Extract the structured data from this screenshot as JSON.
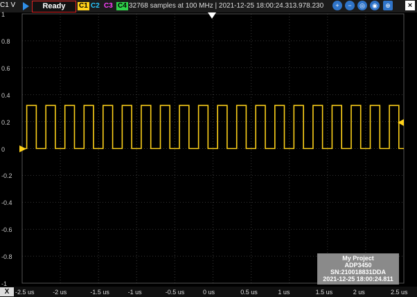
{
  "toolbar": {
    "status": "Ready",
    "channels": [
      "C1",
      "C2",
      "C3",
      "C4"
    ],
    "acquisition": "32768 samples at 100 MHz | 2021-12-25 18:00:24.313.978.230",
    "tool_icons": [
      "zoom-in-icon",
      "zoom-out-icon",
      "zoom-fit-icon",
      "zoom-region-icon",
      "cursor-icon"
    ],
    "close_glyph": "×"
  },
  "channel_unit": "C1 V",
  "y_ticks": [
    "1",
    "0.8",
    "0.6",
    "0.4",
    "0.2",
    "0",
    "-0.2",
    "-0.4",
    "-0.6",
    "-0.8",
    "-1"
  ],
  "x_axis_label": "X",
  "x_ticks": [
    "-2.5 us",
    "-2 us",
    "-1.5 us",
    "-1 us",
    "-0.5 us",
    "0 us",
    "0.5 us",
    "1 us",
    "1.5 us",
    "2 us",
    "2.5 us"
  ],
  "info_box": {
    "line1": "My Project",
    "line2": "ADP3450",
    "line3": "SN:210018831DDA",
    "line4": "2021-12-25 18:00:24.811"
  },
  "colors": {
    "ch1": "#ffd21a",
    "grid": "#3a3a3a",
    "background": "#000000"
  },
  "signal": {
    "x_range_us": [
      -2.5,
      2.5
    ],
    "y_range_v": [
      -1,
      1
    ],
    "low_v": 0.0,
    "high_v": 0.32,
    "period_us": 0.25,
    "duty": 0.5,
    "start_us": -2.44
  }
}
